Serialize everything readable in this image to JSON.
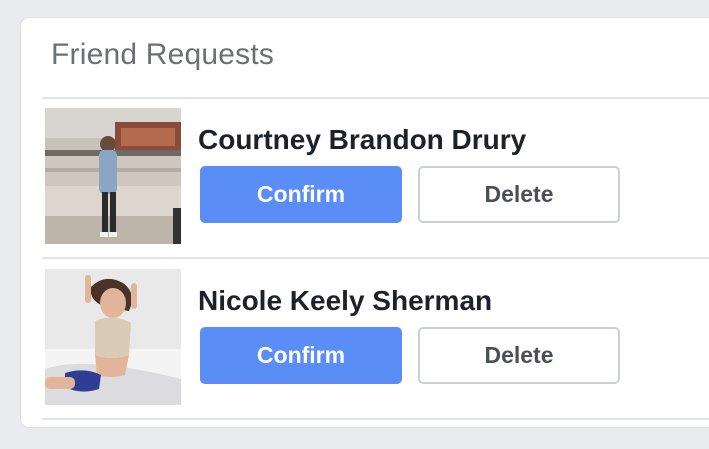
{
  "card": {
    "title": "Friend Requests"
  },
  "requests": [
    {
      "name": "Courtney Brandon Drury",
      "confirm_label": "Confirm",
      "delete_label": "Delete"
    },
    {
      "name": "Nicole Keely Sherman",
      "confirm_label": "Confirm",
      "delete_label": "Delete"
    }
  ],
  "colors": {
    "page_background": "#e9ebee",
    "confirm_button": "#5b8df6",
    "name_text": "#1d2129",
    "title_text": "#6b6f76"
  }
}
